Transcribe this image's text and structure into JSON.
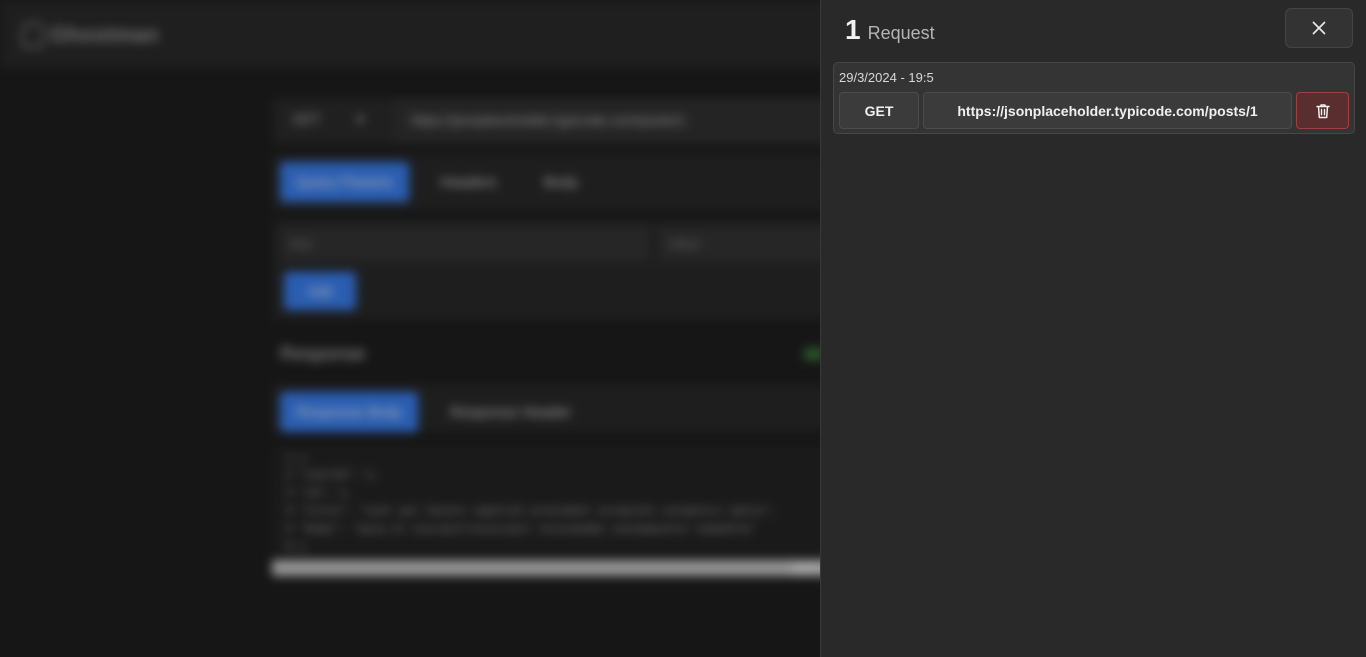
{
  "background_app": {
    "logo_text": "Ghostman",
    "method": "GET",
    "url": "https://jsonplaceholder.typicode.com/posts/1",
    "request_tabs": [
      "Query Params",
      "Headers",
      "Body"
    ],
    "key_placeholder": "Key",
    "value_placeholder": "Value",
    "add_label": "Add",
    "response_title": "Response",
    "response_tabs": [
      "Response Body",
      "Response Header"
    ],
    "code_lines": [
      "1  {",
      "2    \"userId\": 1,",
      "3    \"id\": 1,",
      "4    \"title\": \"sunt aut facere repellat provident occaecati excepturi optio\",",
      "5    \"body\": \"quia et suscipit\\nsuscipit recusandae consequuntur expedita\"",
      "6  }"
    ]
  },
  "drawer": {
    "count": "1",
    "label": "Request",
    "close_icon": "close-icon",
    "history": [
      {
        "timestamp": "29/3/2024 - 19:5",
        "method": "GET",
        "url": "https://jsonplaceholder.typicode.com/posts/1",
        "delete_icon": "trash-icon"
      }
    ]
  },
  "colors": {
    "accent": "#3b82f6",
    "drawer_bg": "#292929",
    "delete_border": "#a14040",
    "delete_bg": "#5a2e2e"
  }
}
